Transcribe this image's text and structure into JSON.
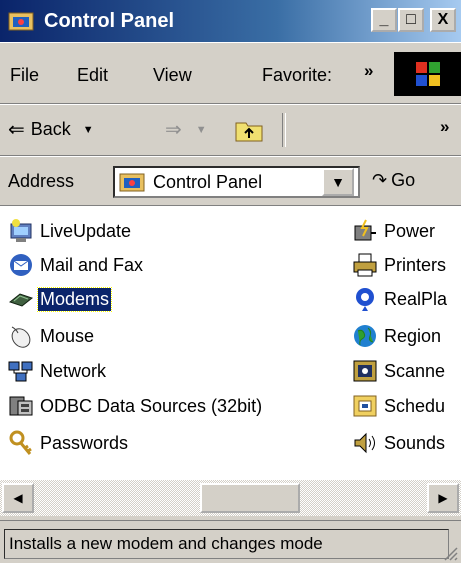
{
  "window": {
    "title": "Control Panel",
    "minimize": "_",
    "maximize": "□",
    "close": "X"
  },
  "menu": {
    "items": [
      {
        "label": "File"
      },
      {
        "label": "Edit"
      },
      {
        "label": "View"
      },
      {
        "label": "Favorite:"
      }
    ],
    "overflow": "»"
  },
  "toolbar": {
    "back_label": "Back",
    "overflow": "»"
  },
  "address": {
    "label": "Address",
    "value": "Control Panel",
    "go_label": "Go"
  },
  "items": {
    "left": [
      {
        "label": "LiveUpdate",
        "icon": "liveupdate-icon"
      },
      {
        "label": "Mail and Fax",
        "icon": "mail-fax-icon"
      },
      {
        "label": "Modems",
        "icon": "modem-icon",
        "selected": true
      },
      {
        "label": "Mouse",
        "icon": "mouse-icon"
      },
      {
        "label": "Network",
        "icon": "network-icon"
      },
      {
        "label": "ODBC Data Sources (32bit)",
        "icon": "odbc-icon"
      },
      {
        "label": "Passwords",
        "icon": "passwords-icon"
      }
    ],
    "right": [
      {
        "label": "Power",
        "icon": "power-icon"
      },
      {
        "label": "Printers",
        "icon": "printers-icon"
      },
      {
        "label": "RealPla",
        "icon": "realplayer-icon"
      },
      {
        "label": "Region",
        "icon": "regional-icon"
      },
      {
        "label": "Scanne",
        "icon": "scanners-icon"
      },
      {
        "label": "Schedu",
        "icon": "scheduled-icon"
      },
      {
        "label": "Sounds",
        "icon": "sounds-icon"
      }
    ]
  },
  "status": {
    "text": "Installs a new modem and changes mode"
  },
  "colors": {
    "title_active": "#0a246a",
    "face": "#d4d0c8",
    "selection": "#0a246a"
  }
}
